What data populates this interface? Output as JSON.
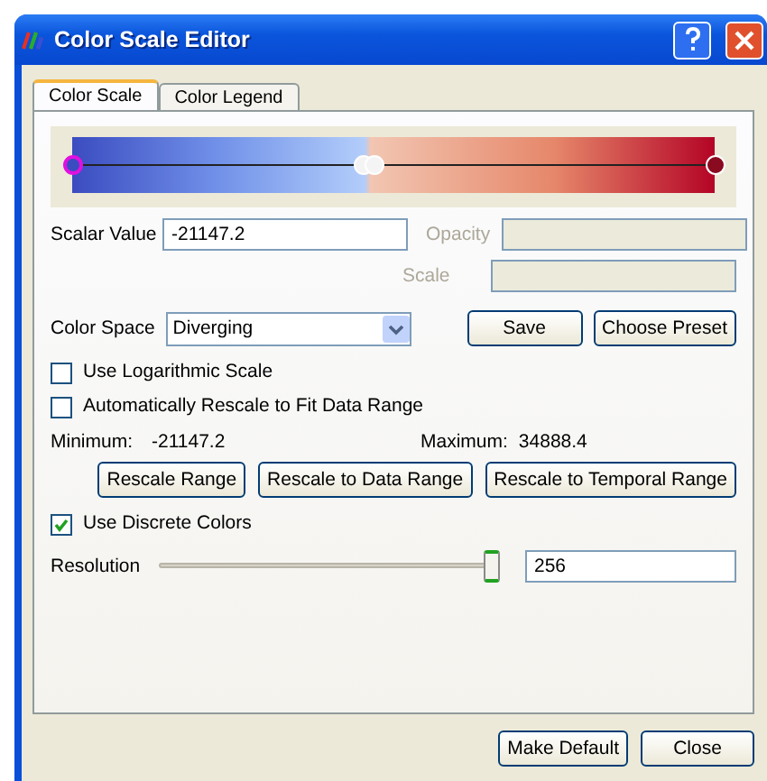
{
  "window": {
    "title": "Color Scale Editor"
  },
  "tabs": [
    {
      "label": "Color Scale",
      "selected": true
    },
    {
      "label": "Color Legend",
      "selected": false
    }
  ],
  "color_scale": {
    "points": [
      {
        "level": 0,
        "selected": true
      },
      {
        "level": 0.452,
        "selected": false
      },
      {
        "level": 0.47,
        "selected": false
      },
      {
        "level": 1,
        "selected": false
      }
    ]
  },
  "scalar_value": {
    "label": "Scalar Value",
    "value": "-21147.2"
  },
  "opacity": {
    "label": "Opacity",
    "disabled": true
  },
  "scale": {
    "label": "Scale",
    "disabled": true
  },
  "color_space": {
    "label": "Color Space",
    "value": "Diverging"
  },
  "save_button": "Save",
  "preset_button": "Choose Preset",
  "options": [
    {
      "label": "Use Logarithmic Scale",
      "checked": false
    },
    {
      "label": "Automatically Rescale to Fit Data Range",
      "checked": false
    }
  ],
  "range": {
    "min_label": "Minimum:",
    "min_value": "-21147.2",
    "max_label": "Maximum:",
    "max_value": "34888.4"
  },
  "rescale_buttons": [
    "Rescale Range",
    "Rescale to Data Range",
    "Rescale to Temporal Range"
  ],
  "discrete": {
    "label": "Use Discrete Colors",
    "checked": true
  },
  "resolution": {
    "label": "Resolution",
    "level": 1,
    "value": "256"
  },
  "footer_buttons": [
    "Make Default",
    "Close"
  ]
}
